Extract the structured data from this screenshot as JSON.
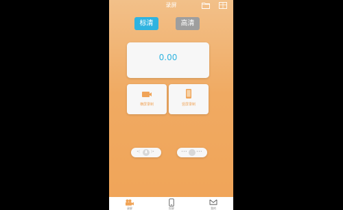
{
  "header": {
    "title": "录屏",
    "icons": [
      "folder-icon",
      "box-icon"
    ]
  },
  "quality_tabs": [
    {
      "label": "标清",
      "selected": true,
      "color": "#2fb3e0"
    },
    {
      "label": "高清",
      "selected": false,
      "color": "#9e9e9e"
    }
  ],
  "timer": {
    "value": "0.00"
  },
  "modes": [
    {
      "label": "横屏录制",
      "icon": "landscape-video-icon"
    },
    {
      "label": "竖屏录制",
      "icon": "portrait-phone-icon"
    }
  ],
  "toggles": [
    {
      "icon": "microphone-icon",
      "state": "off"
    },
    {
      "icon": "dots-icon",
      "state": "off"
    }
  ],
  "bottom_nav": [
    {
      "label": "录屏",
      "icon": "video-camera-icon",
      "active": true
    },
    {
      "label": "投屏",
      "icon": "phone-icon",
      "active": false
    },
    {
      "label": "我的",
      "icon": "envelope-icon",
      "active": false
    }
  ],
  "colors": {
    "accent": "#2fb3e0",
    "background_top": "#f2c089",
    "background_bottom": "#f0a458",
    "card": "#f7f7f7"
  }
}
